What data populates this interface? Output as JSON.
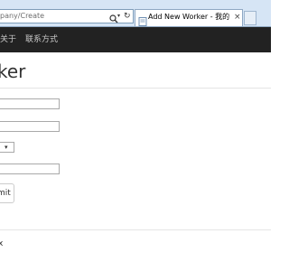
{
  "browser": {
    "address": "pany/Create",
    "tab_title": "Add New Worker - 我的 ...",
    "tab_close": "×",
    "refresh_glyph": "↻",
    "dropdown_glyph": "▾"
  },
  "navbar": {
    "items": [
      {
        "label": "关于"
      },
      {
        "label": "联系方式"
      }
    ]
  },
  "main": {
    "title": "ker",
    "select_glyph": "▾",
    "submit_label": "mit"
  },
  "footer": {
    "text": "x"
  },
  "colors": {
    "navbar_bg": "#222222",
    "chrome_bg": "#d6e5f5",
    "tab_border": "#8fa8c3",
    "text": "#333333"
  }
}
